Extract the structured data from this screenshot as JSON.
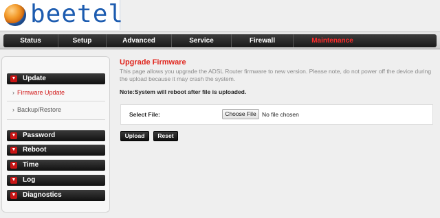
{
  "logo": {
    "text": "beetel"
  },
  "nav": {
    "items": [
      {
        "label": "Status",
        "active": false
      },
      {
        "label": "Setup",
        "active": false
      },
      {
        "label": "Advanced",
        "active": false
      },
      {
        "label": "Service",
        "active": false
      },
      {
        "label": "Firewall",
        "active": false
      },
      {
        "label": "Maintenance",
        "active": true
      }
    ],
    "active_color": "#ff2a2a"
  },
  "sidebar": {
    "update_header": "Update",
    "firmware_update": "Firmware Update",
    "backup_restore": "Backup/Restore",
    "password": "Password",
    "reboot": "Reboot",
    "time": "Time",
    "log": "Log",
    "diagnostics": "Diagnostics",
    "chevron_icon": "chevron-down-icon",
    "sub_arrow": "›"
  },
  "main": {
    "title": "Upgrade Firmware",
    "description": "This page allows you upgrade the ADSL Router firmware to new version. Please note, do not power off the device during the upload because it may crash the system.",
    "note": "Note:System will reboot after file is uploaded.",
    "select_file_label": "Select File:",
    "choose_file_button": "Choose File",
    "file_status": "No file chosen",
    "upload_button": "Upload",
    "reset_button": "Reset"
  },
  "colors": {
    "accent_red": "#e0241c",
    "nav_dark": "#1a1a1a",
    "logo_blue": "#1d5cb0"
  }
}
